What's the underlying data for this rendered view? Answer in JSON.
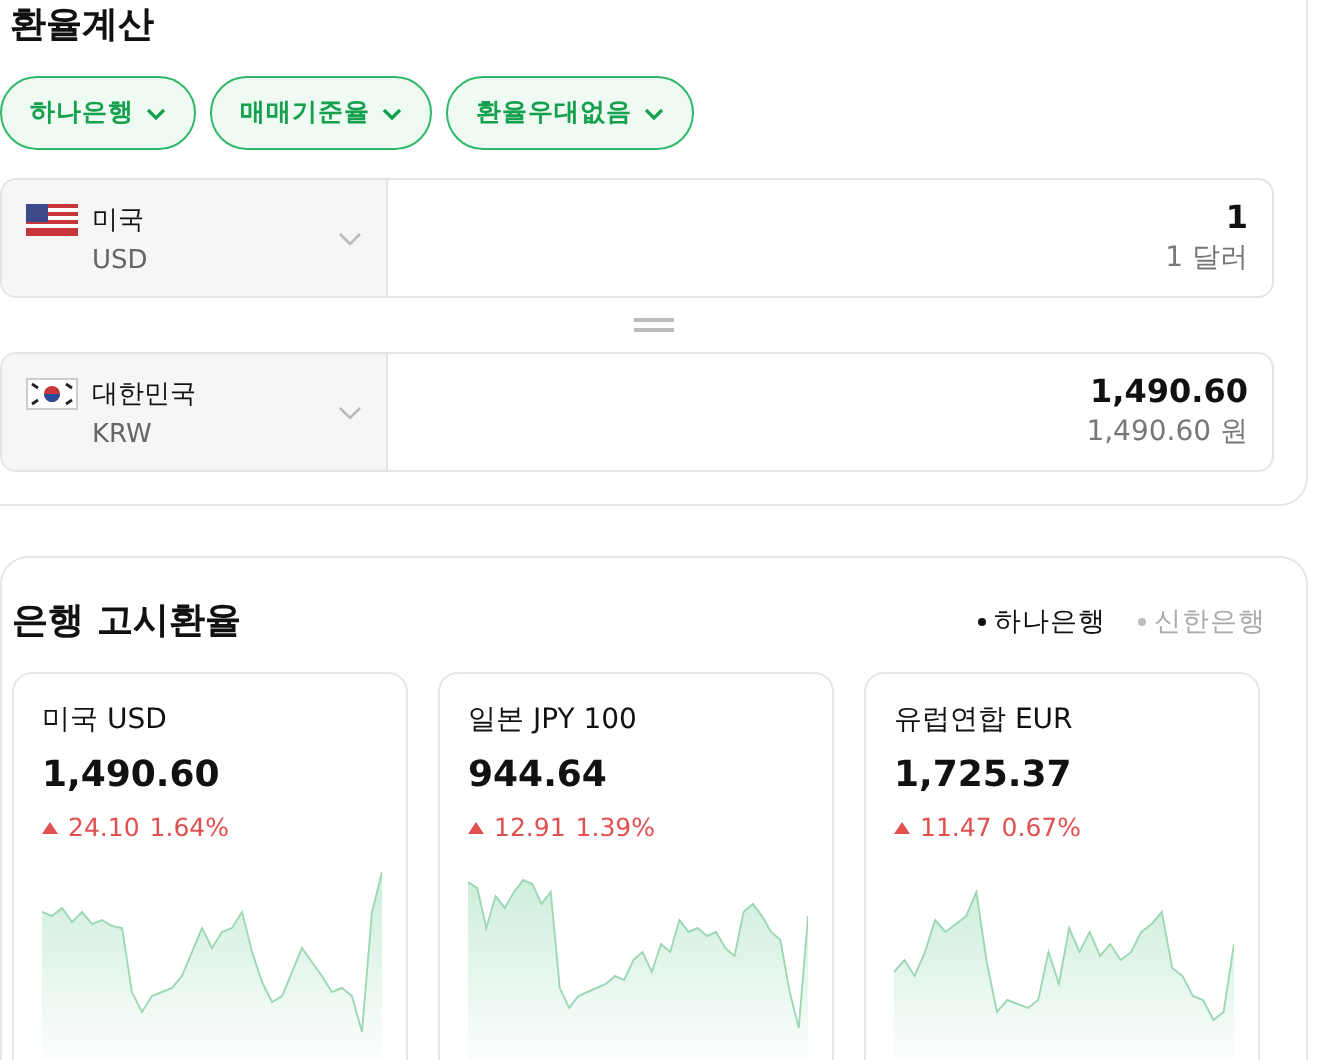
{
  "title": "환율계산",
  "filters": [
    {
      "label": "하나은행"
    },
    {
      "label": "매매기준율"
    },
    {
      "label": "환율우대없음"
    }
  ],
  "converter": [
    {
      "country": "미국",
      "code": "USD",
      "amount": "1",
      "amount_text": "1 달러"
    },
    {
      "country": "대한민국",
      "code": "KRW",
      "amount": "1,490.60",
      "amount_text": "1,490.60 원"
    }
  ],
  "rates_section": {
    "title": "은행 고시환율",
    "banks": [
      {
        "label": "하나은행",
        "selected": true
      },
      {
        "label": "신한은행",
        "selected": false
      }
    ],
    "cards": [
      {
        "name": "미국 USD",
        "rate": "1,490.60",
        "change": "24.10",
        "percent": "1.64%",
        "kind": "up"
      },
      {
        "name": "일본 JPY 100",
        "rate": "944.64",
        "change": "12.91",
        "percent": "1.39%",
        "kind": "up"
      },
      {
        "name": "유럽연합 EUR",
        "rate": "1,725.37",
        "change": "11.47",
        "percent": "0.67%",
        "kind": "up"
      }
    ]
  }
}
